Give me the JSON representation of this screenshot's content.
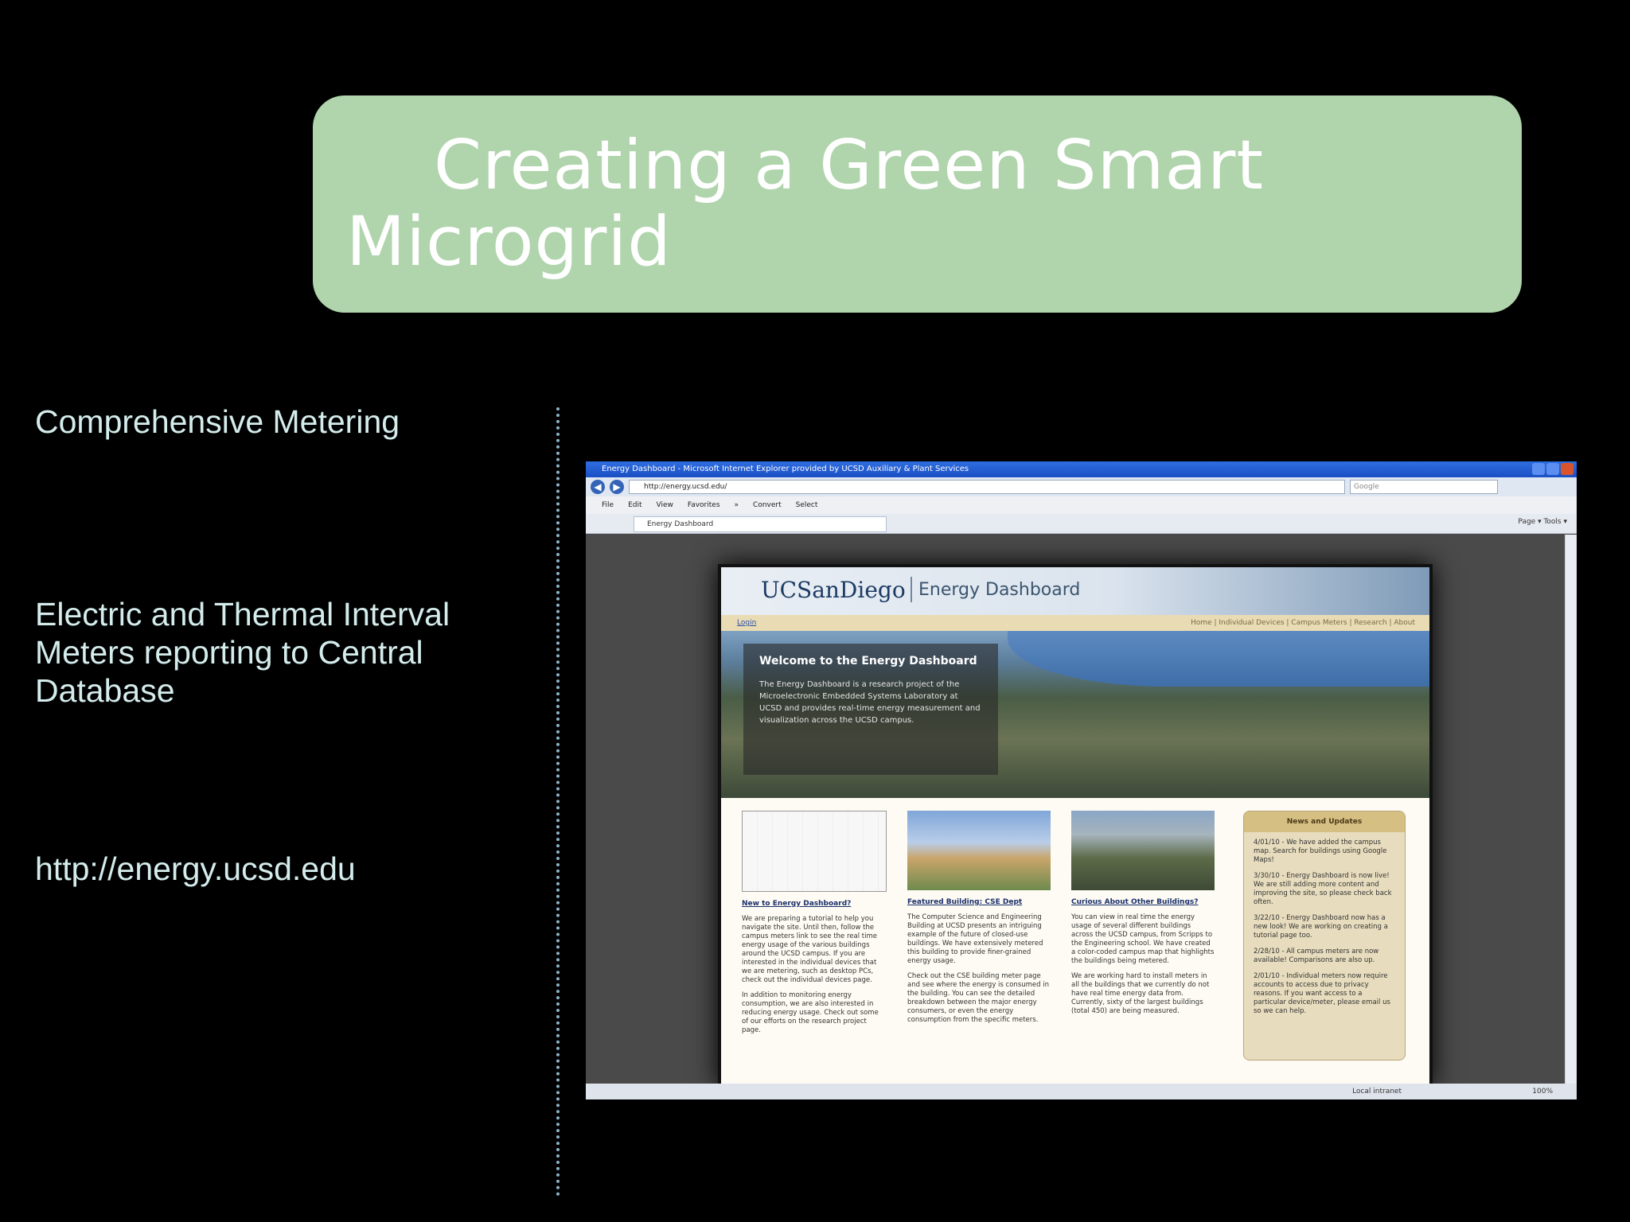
{
  "slide": {
    "title": "Creating a Green Smart Microgrid",
    "bullets": [
      "Comprehensive Metering",
      "Electric and Thermal Interval Meters reporting to Central Database",
      "http://energy.ucsd.edu"
    ]
  },
  "browser": {
    "window_title": "Energy Dashboard - Microsoft Internet Explorer provided by UCSD Auxiliary & Plant Services",
    "address": "http://energy.ucsd.edu/",
    "search_placeholder": "Google",
    "menu": [
      "File",
      "Edit",
      "View",
      "Favorites",
      "»",
      "Convert",
      "Select"
    ],
    "tab_label": "Energy Dashboard",
    "toolbar_right": "Page ▾  Tools ▾",
    "status_zone": "Local intranet",
    "status_zoom": "100%"
  },
  "site": {
    "logo": "UCSanDiego",
    "title": "Energy Dashboard",
    "login": "Login",
    "nav_links": "Home | Individual Devices | Campus Meters | Research | About",
    "welcome_title": "Welcome to the Energy Dashboard",
    "welcome_text": "The Energy Dashboard is a research project of the Microelectronic Embedded Systems Laboratory at UCSD and provides real-time energy measurement and visualization across the UCSD campus.",
    "col1_title": "New to Energy Dashboard?",
    "col1_p1": "We are preparing a tutorial to help you navigate the site. Until then, follow the campus meters link to see the real time energy usage of the various buildings around the UCSD campus. If you are interested in the individual devices that we are metering, such as desktop PCs, check out the individual devices page.",
    "col1_p2": "In addition to monitoring energy consumption, we are also interested in reducing energy usage. Check out some of our efforts on the research project page.",
    "col2_title": "Featured Building: CSE Dept",
    "col2_p1": "The Computer Science and Engineering Building at UCSD presents an intriguing example of the future of closed-use buildings. We have extensively metered this building to provide finer-grained energy usage.",
    "col2_p2": "Check out the CSE building meter page and see where the energy is consumed in the building. You can see the detailed breakdown between the major energy consumers, or even the energy consumption from the specific meters.",
    "col3_title": "Curious About Other Buildings?",
    "col3_p1": "You can view in real time the energy usage of several different buildings across the UCSD campus, from Scripps to the Engineering school. We have created a color-coded campus map that highlights the buildings being metered.",
    "col3_p2": "We are working hard to install meters in all the buildings that we currently do not have real time energy data from. Currently, sixty of the largest buildings (total 450) are being measured.",
    "news_title": "News and Updates",
    "news": [
      "4/01/10 - We have added the campus map. Search for buildings using Google Maps!",
      "3/30/10 - Energy Dashboard is now live! We are still adding more content and improving the site, so please check back often.",
      "3/22/10 - Energy Dashboard now has a new look! We are working on creating a tutorial page too.",
      "2/28/10 - All campus meters are now available! Comparisons are also up.",
      "2/01/10 - Individual meters now require accounts to access due to privacy reasons. If you want access to a particular device/meter, please email us so we can help."
    ]
  }
}
